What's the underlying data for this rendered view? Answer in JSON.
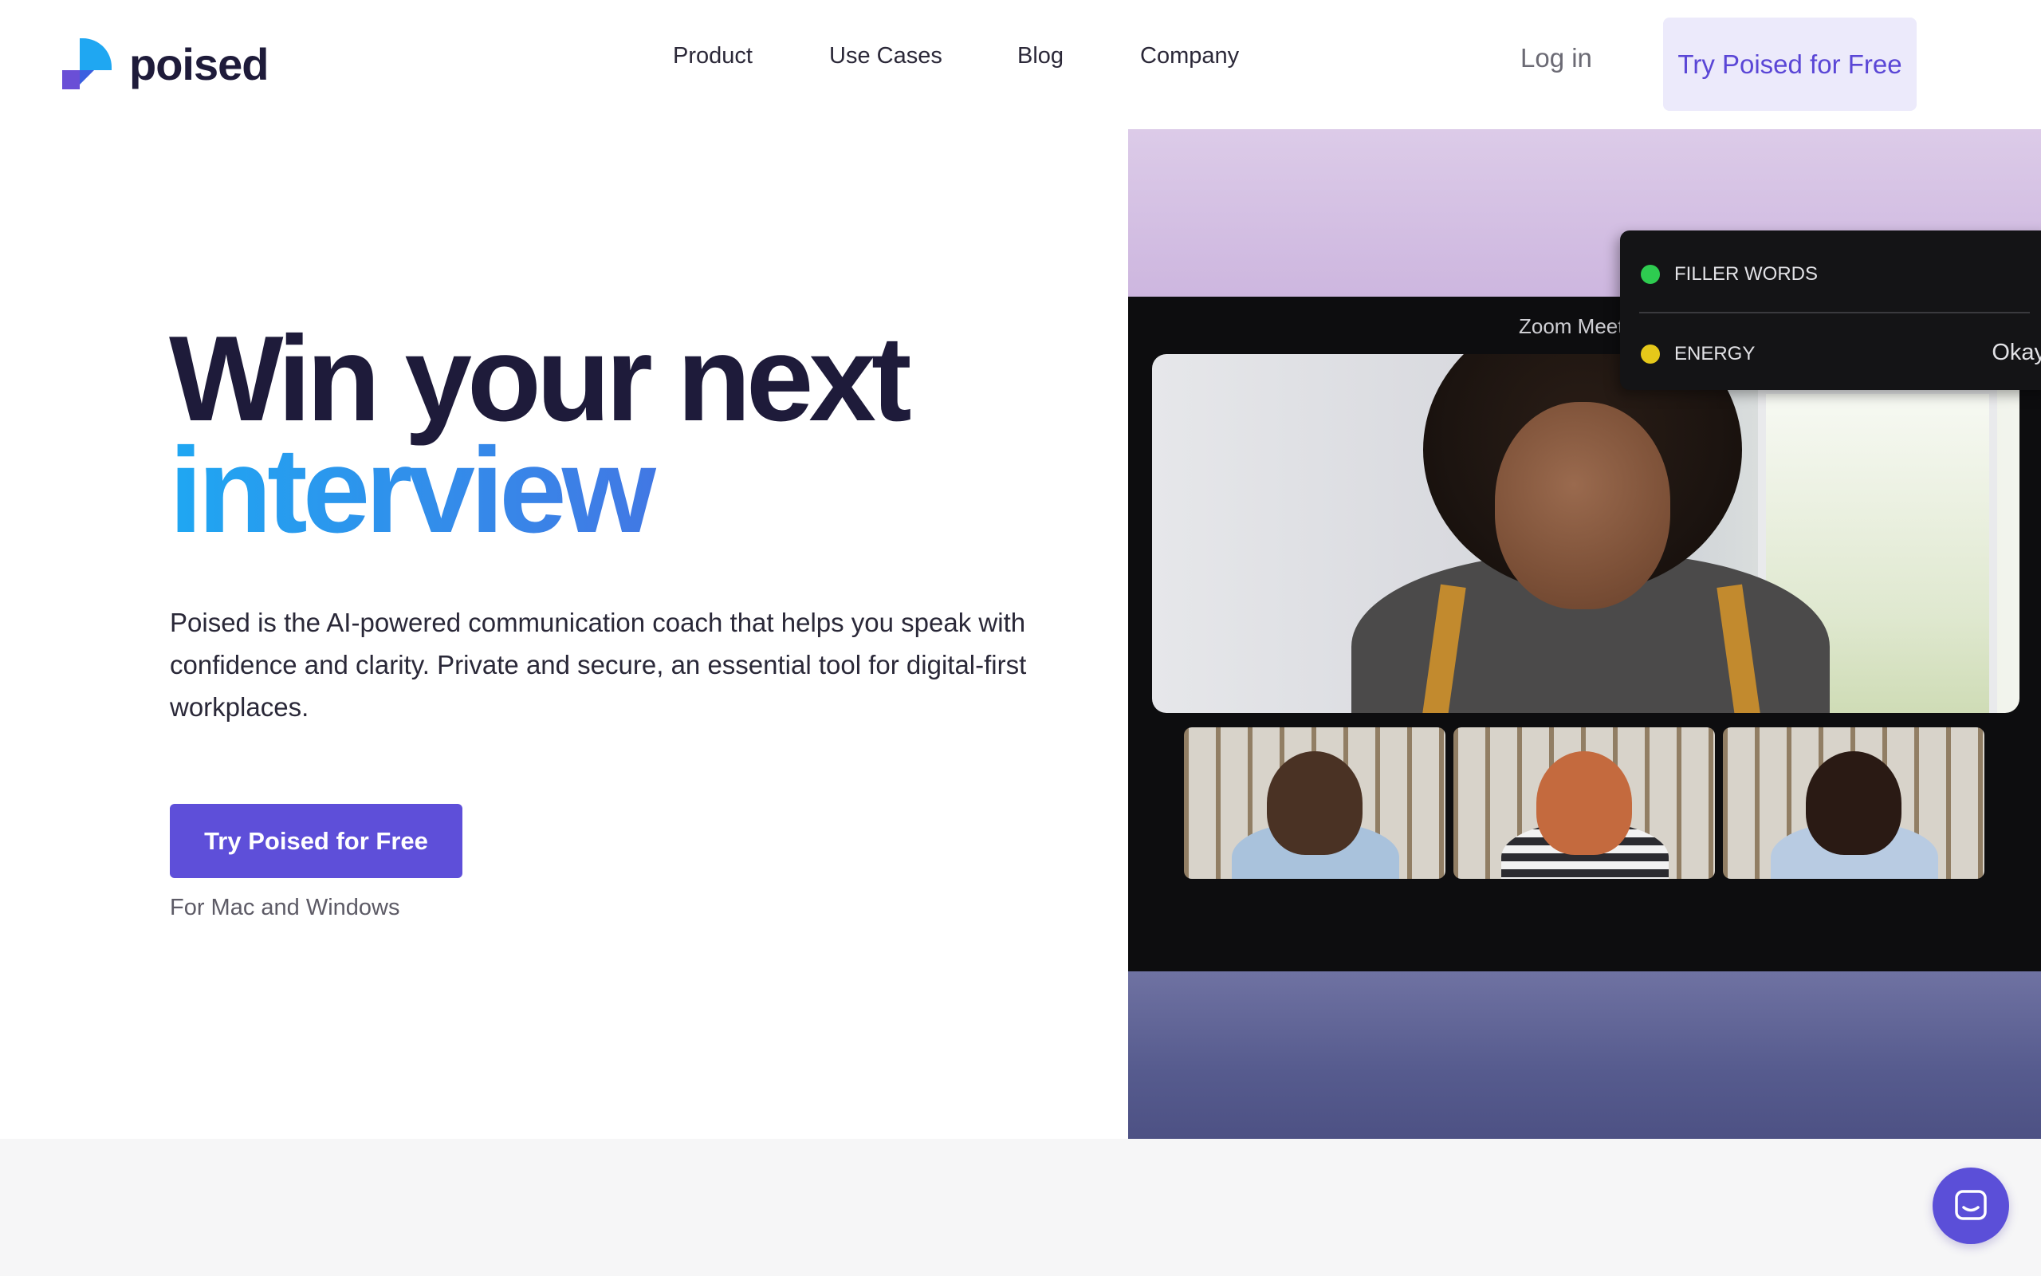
{
  "brand": {
    "name": "poised"
  },
  "nav": {
    "items": [
      {
        "label": "Product"
      },
      {
        "label": "Use Cases"
      },
      {
        "label": "Blog"
      },
      {
        "label": "Company"
      }
    ],
    "login_label": "Log in",
    "cta_label": "Try Poised for Free"
  },
  "hero": {
    "headline_line1": "Win your next",
    "headline_line2": "interview",
    "description": "Poised is the AI-powered communication coach that helps you speak with confidence and clarity. Private and secure, an essential tool for digital-first workplaces.",
    "cta_label": "Try Poised for Free",
    "platforms_note": "For Mac and Windows"
  },
  "media": {
    "window_title": "Zoom Meet",
    "metrics": [
      {
        "label": "FILLER WORDS",
        "status_color": "#2ecc50",
        "value": ""
      },
      {
        "label": "ENERGY",
        "status_color": "#e5c81a",
        "value": "Okay"
      }
    ]
  },
  "colors": {
    "brand_purple": "#5e4fd9",
    "brand_blue": "#1fa7f2",
    "heading_navy": "#1e1b3a",
    "cta_tint": "#eceafb"
  },
  "icons": {
    "logo": "poised-logo-icon",
    "chat": "chat-bubble-icon"
  }
}
